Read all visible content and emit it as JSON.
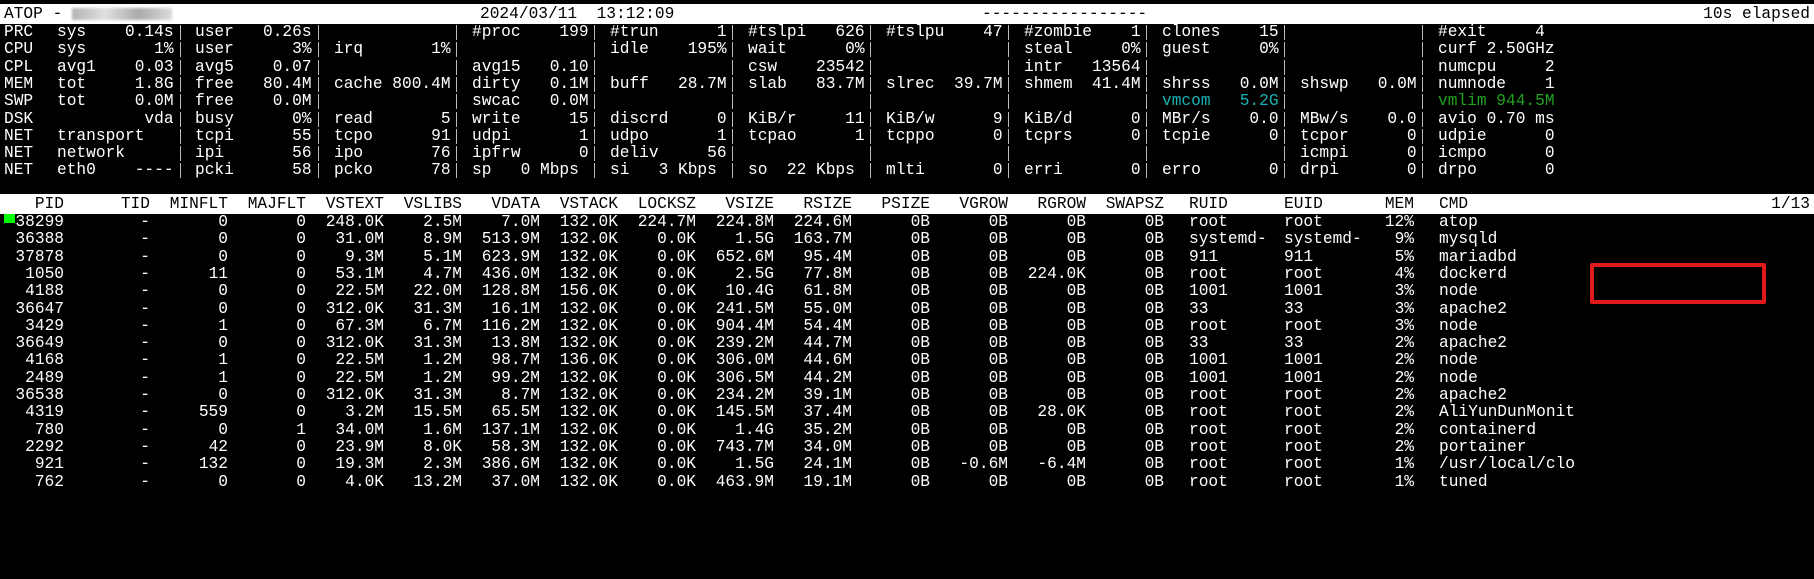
{
  "header": {
    "title": "ATOP - ",
    "hostname": "",
    "datetime": "2024/03/11  13:12:09",
    "dashes": "-----------------",
    "elapsed": "10s elapsed"
  },
  "stats": [
    {
      "label": "PRC",
      "cells": [
        "sys    0.14s",
        "user   0.26s",
        "",
        "#proc    199",
        "#trun      1",
        "#tslpi   626",
        "#tslpu    47",
        "#zombie    1",
        "clones    15",
        "",
        "#exit     4"
      ]
    },
    {
      "label": "CPU",
      "cells": [
        "sys       1%",
        "user      3%",
        "irq       1%",
        "",
        "idle    195%",
        "wait      0%",
        "",
        "steal     0%",
        "guest     0%",
        "",
        "curf 2.50GHz"
      ]
    },
    {
      "label": "CPL",
      "cells": [
        "avg1    0.03",
        "avg5    0.07",
        "",
        "avg15   0.10",
        "",
        "csw    23542",
        "",
        "intr   13564",
        "",
        "",
        "numcpu     2"
      ]
    },
    {
      "label": "MEM",
      "cells": [
        "tot     1.8G",
        "free   80.4M",
        "cache 800.4M",
        "dirty   0.1M",
        "buff   28.7M",
        "slab   83.7M",
        "slrec  39.7M",
        "shmem  41.4M",
        "shrss   0.0M",
        "shswp   0.0M",
        "numnode    1"
      ]
    },
    {
      "label": "SWP",
      "cells": [
        "tot     0.0M",
        "free    0.0M",
        "",
        "swcac   0.0M",
        "",
        "",
        "",
        "",
        "vmcom   5.2G",
        "",
        "vmlim 944.5M"
      ]
    },
    {
      "label": "DSK",
      "cells": [
        "         vda",
        "busy      0%",
        "read       5",
        "write     15",
        "discrd     0",
        "KiB/r     11",
        "KiB/w      9",
        "KiB/d      0",
        "MBr/s    0.0",
        "MBw/s    0.0",
        "avio 0.70 ms"
      ]
    },
    {
      "label": "NET",
      "cells": [
        "transport",
        "tcpi      55",
        "tcpo      91",
        "udpi       1",
        "udpo       1",
        "tcpao      1",
        "tcppo      0",
        "tcprs      0",
        "tcpie      0",
        "tcpor      0",
        "udpie      0"
      ]
    },
    {
      "label": "NET",
      "cells": [
        "network",
        "ipi       56",
        "ipo       76",
        "ipfrw      0",
        "deliv     56",
        "",
        "",
        "",
        "",
        "icmpi      0",
        "icmpo      0"
      ]
    },
    {
      "label": "NET",
      "cells": [
        "eth0    ----",
        "pcki      58",
        "pcko      78",
        "sp   0 Mbps",
        "si   3 Kbps",
        "so  22 Kbps",
        "mlti       0",
        "erri       0",
        "erro       0",
        "drpi       0",
        "drpo       0"
      ]
    }
  ],
  "process_table": {
    "headers": [
      "PID",
      "TID",
      "MINFLT",
      "MAJFLT",
      "VSTEXT",
      "VSLIBS",
      "VDATA",
      "VSTACK",
      "LOCKSZ",
      "VSIZE",
      "RSIZE",
      "PSIZE",
      "VGROW",
      "RGROW",
      "SWAPSZ",
      "RUID",
      "EUID",
      "MEM",
      "CMD"
    ],
    "page": "1/13",
    "rows": [
      [
        "38299",
        "-",
        "0",
        "0",
        "248.0K",
        "2.5M",
        "7.0M",
        "132.0K",
        "224.7M",
        "224.8M",
        "224.6M",
        "0B",
        "0B",
        "0B",
        "0B",
        "root",
        "root",
        "12%",
        "atop"
      ],
      [
        "36388",
        "-",
        "0",
        "0",
        "31.0M",
        "8.9M",
        "513.9M",
        "132.0K",
        "0.0K",
        "1.5G",
        "163.7M",
        "0B",
        "0B",
        "0B",
        "0B",
        "systemd-",
        "systemd-",
        "9%",
        "mysqld"
      ],
      [
        "37878",
        "-",
        "0",
        "0",
        "9.3M",
        "5.1M",
        "623.9M",
        "132.0K",
        "0.0K",
        "652.6M",
        "95.4M",
        "0B",
        "0B",
        "0B",
        "0B",
        "911",
        "911",
        "5%",
        "mariadbd"
      ],
      [
        "1050",
        "-",
        "11",
        "0",
        "53.1M",
        "4.7M",
        "436.0M",
        "132.0K",
        "0.0K",
        "2.5G",
        "77.8M",
        "0B",
        "0B",
        "224.0K",
        "0B",
        "root",
        "root",
        "4%",
        "dockerd"
      ],
      [
        "4188",
        "-",
        "0",
        "0",
        "22.5M",
        "22.0M",
        "128.8M",
        "156.0K",
        "0.0K",
        "10.4G",
        "61.8M",
        "0B",
        "0B",
        "0B",
        "0B",
        "1001",
        "1001",
        "3%",
        "node"
      ],
      [
        "36647",
        "-",
        "0",
        "0",
        "312.0K",
        "31.3M",
        "16.1M",
        "132.0K",
        "0.0K",
        "241.5M",
        "55.0M",
        "0B",
        "0B",
        "0B",
        "0B",
        "33",
        "33",
        "3%",
        "apache2"
      ],
      [
        "3429",
        "-",
        "1",
        "0",
        "67.3M",
        "6.7M",
        "116.2M",
        "132.0K",
        "0.0K",
        "904.4M",
        "54.4M",
        "0B",
        "0B",
        "0B",
        "0B",
        "root",
        "root",
        "3%",
        "node"
      ],
      [
        "36649",
        "-",
        "0",
        "0",
        "312.0K",
        "31.3M",
        "13.8M",
        "132.0K",
        "0.0K",
        "239.2M",
        "44.7M",
        "0B",
        "0B",
        "0B",
        "0B",
        "33",
        "33",
        "2%",
        "apache2"
      ],
      [
        "4168",
        "-",
        "1",
        "0",
        "22.5M",
        "1.2M",
        "98.7M",
        "136.0K",
        "0.0K",
        "306.0M",
        "44.6M",
        "0B",
        "0B",
        "0B",
        "0B",
        "1001",
        "1001",
        "2%",
        "node"
      ],
      [
        "2489",
        "-",
        "1",
        "0",
        "22.5M",
        "1.2M",
        "99.2M",
        "132.0K",
        "0.0K",
        "306.5M",
        "44.2M",
        "0B",
        "0B",
        "0B",
        "0B",
        "1001",
        "1001",
        "2%",
        "node"
      ],
      [
        "36538",
        "-",
        "0",
        "0",
        "312.0K",
        "31.3M",
        "8.7M",
        "132.0K",
        "0.0K",
        "234.2M",
        "39.1M",
        "0B",
        "0B",
        "0B",
        "0B",
        "root",
        "root",
        "2%",
        "apache2"
      ],
      [
        "4319",
        "-",
        "559",
        "0",
        "3.2M",
        "15.5M",
        "65.5M",
        "132.0K",
        "0.0K",
        "145.5M",
        "37.4M",
        "0B",
        "0B",
        "28.0K",
        "0B",
        "root",
        "root",
        "2%",
        "AliYunDunMonit"
      ],
      [
        "780",
        "-",
        "0",
        "1",
        "34.0M",
        "1.6M",
        "137.1M",
        "132.0K",
        "0.0K",
        "1.4G",
        "35.2M",
        "0B",
        "0B",
        "0B",
        "0B",
        "root",
        "root",
        "2%",
        "containerd"
      ],
      [
        "2292",
        "-",
        "42",
        "0",
        "23.9M",
        "8.0K",
        "58.3M",
        "132.0K",
        "0.0K",
        "743.7M",
        "34.0M",
        "0B",
        "0B",
        "0B",
        "0B",
        "root",
        "root",
        "2%",
        "portainer"
      ],
      [
        "921",
        "-",
        "132",
        "0",
        "19.3M",
        "2.3M",
        "386.6M",
        "132.0K",
        "0.0K",
        "1.5G",
        "24.1M",
        "0B",
        "-0.6M",
        "-6.4M",
        "0B",
        "root",
        "root",
        "1%",
        "/usr/local/clo"
      ],
      [
        "762",
        "-",
        "0",
        "0",
        "4.0K",
        "13.2M",
        "37.0M",
        "132.0K",
        "0.0K",
        "463.9M",
        "19.1M",
        "0B",
        "0B",
        "0B",
        "0B",
        "root",
        "root",
        "1%",
        "tuned"
      ]
    ]
  },
  "colors": {
    "background": "#000000",
    "text": "#ffffff",
    "header_bar": "#ffffff",
    "cursor": "#00ff00",
    "vmcom": "#18b2b2",
    "vmlim": "#1fa31f",
    "highlight": "#e01a1a"
  }
}
